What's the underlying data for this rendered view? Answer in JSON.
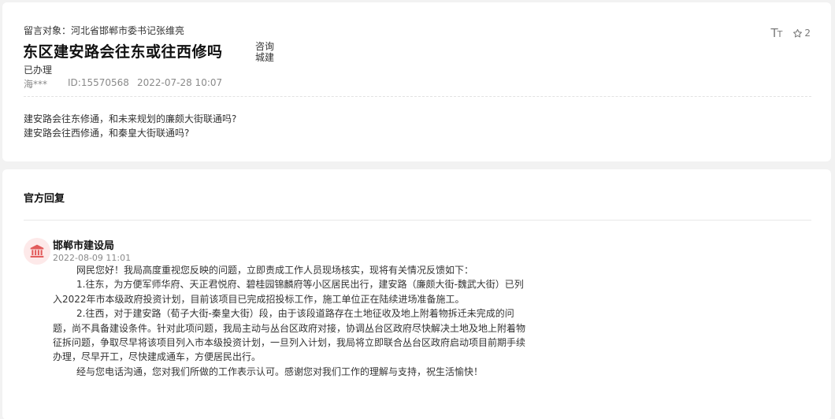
{
  "message": {
    "target": "留言对象：河北省邯郸市委书记张维亮",
    "title": "东区建安路会往东或往西修吗",
    "tags": [
      "咨询",
      "城建"
    ],
    "status": "已办理",
    "user": "海***",
    "id": "ID:15570568",
    "time": "2022-07-28 10:07",
    "font_toggle": {
      "big": "T",
      "small": "T"
    },
    "favorites": "2",
    "content": [
      "建安路会往东修通，和未来规划的廉颇大街联通吗?",
      "建安路会往西修通，和秦皇大街联通吗?"
    ]
  },
  "reply": {
    "heading": "官方回复",
    "org": "邯郸市建设局",
    "time": "2022-08-09 11:01",
    "paragraphs": [
      "网民您好！我局高度重视您反映的问题，立即责成工作人员现场核实，现将有关情况反馈如下：",
      "1.往东，为方便军师华府、天正君悦府、碧桂园锦麟府等小区居民出行，建安路（廉颇大街-魏武大街）已列入2022年市本级政府投资计划，目前该项目已完成招投标工作，施工单位正在陆续进场准备施工。",
      "2.往西，对于建安路（荀子大街-秦皇大街）段，由于该段道路存在土地征收及地上附着物拆迁未完成的问题，尚不具备建设条件。针对此项问题，我局主动与丛台区政府对接，协调丛台区政府尽快解决土地及地上附着物征拆问题，争取尽早将该项目列入市本级投资计划，一旦列入计划，我局将立即联合丛台区政府启动项目前期手续办理，尽早开工，尽快建成通车，方便居民出行。",
      "经与您电话沟通，您对我们所做的工作表示认可。感谢您对我们工作的理解与支持，祝生活愉快！"
    ]
  },
  "icons": {
    "favorite": "star-outline-icon",
    "org_avatar": "government-building-icon"
  },
  "colors": {
    "avatar_bg": "#fde9e9",
    "avatar_icon": "#e25b5b",
    "meta_gray": "#8a8a8a"
  }
}
